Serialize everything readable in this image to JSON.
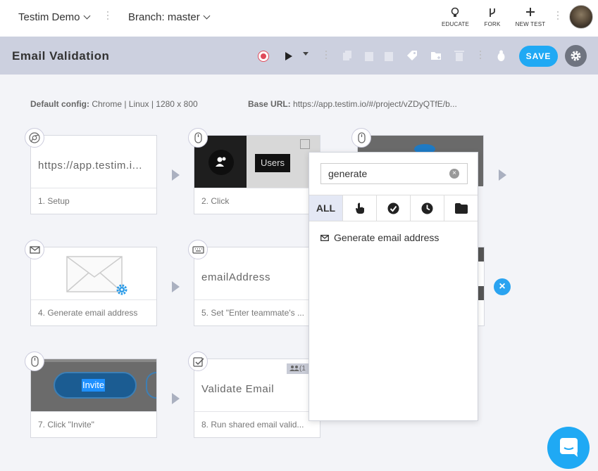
{
  "topnav": {
    "project": "Testim Demo",
    "branch": "Branch: master",
    "educate": "EDUCATE",
    "fork": "FORK",
    "new_test": "NEW TEST"
  },
  "toolbar": {
    "title": "Email Validation",
    "save": "SAVE"
  },
  "config": {
    "default_label": "Default config:",
    "default_value": "Chrome | Linux | 1280 x 800",
    "base_label": "Base URL:",
    "base_value": "https://app.testim.io/#/project/vZDyQTfE/b..."
  },
  "steps": [
    {
      "caption": "1. Setup",
      "text": "https://app.testim.i...",
      "icon": "chrome-icon"
    },
    {
      "caption": "2. Click",
      "tooltip": "Users",
      "icon": "mouse-icon"
    },
    {
      "caption": "",
      "icon": "mouse-icon"
    },
    {
      "caption": "4. Generate email address",
      "icon": "mail-icon"
    },
    {
      "caption": "5. Set \"Enter teammate's ...",
      "text": "emailAddress",
      "icon": "keyboard-icon"
    },
    {
      "caption": "7. Click \"Invite\"",
      "button": "Invite",
      "icon": "mouse-icon"
    },
    {
      "caption": "8. Run shared email valid...",
      "text": "Validate Email",
      "tag": "(1",
      "icon": "check-icon"
    }
  ],
  "popup": {
    "search_value": "generate",
    "tab_all": "ALL",
    "result": "Generate email address"
  },
  "colors": {
    "accent": "#1fa9f4",
    "record": "#e04a5b",
    "header_bg": "#ccd0df"
  }
}
